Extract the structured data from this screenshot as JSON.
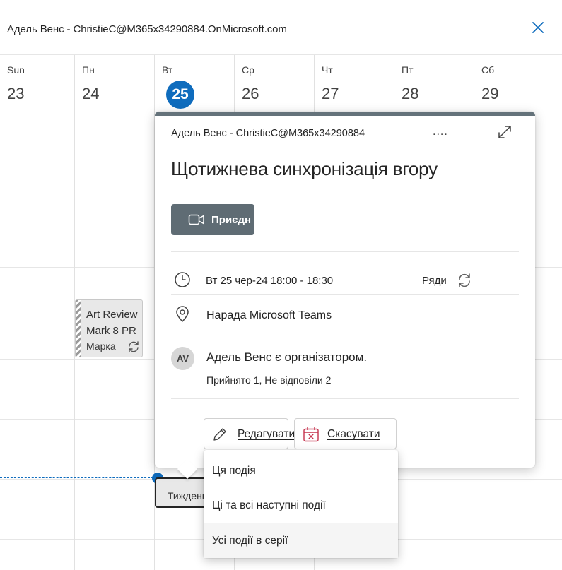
{
  "header": {
    "title": "Адель Венс - ChristieC@M365x34290884.OnMicrosoft.com",
    "close_icon": "close-icon"
  },
  "days": [
    {
      "name": "Sun",
      "num": "23",
      "today": false
    },
    {
      "name": "Пн",
      "num": "24",
      "today": false
    },
    {
      "name": "Вт",
      "num": "25",
      "today": true
    },
    {
      "name": "Ср",
      "num": "26",
      "today": false
    },
    {
      "name": "Чт",
      "num": "27",
      "today": false
    },
    {
      "name": "Пт",
      "num": "28",
      "today": false
    },
    {
      "name": "Сб",
      "num": "29",
      "today": false
    }
  ],
  "events": {
    "art_review": {
      "line1": "Art Review",
      "line2": "Mark 8 PR",
      "line3": "Марка"
    },
    "weekly": {
      "label": "Тиждень"
    }
  },
  "popup": {
    "owner": "Адель Венс - ChristieC@M365x34290884",
    "more": "....",
    "title": "Щотижнева синхронізація вгору",
    "join_label": "Приєдн",
    "when": "Вт 25 чер-24 18:00 - 18:30",
    "series_label": "Ряди",
    "location": "Нарада Microsoft Teams",
    "avatar_initials": "AV",
    "organizer": "Адель Венс є організатором.",
    "responses": "Прийнято 1, Не відповіли 2",
    "edit_label": "Редагувати",
    "cancel_label": "Скасувати"
  },
  "menu": {
    "items": [
      "Ця подія",
      "Ці та всі наступні події",
      "Усі події в серії"
    ]
  },
  "colors": {
    "accent": "#0f6cbd",
    "popup_bar": "#64727a",
    "join_button": "#5f6c74",
    "cancel_icon_red": "#c4314b"
  }
}
